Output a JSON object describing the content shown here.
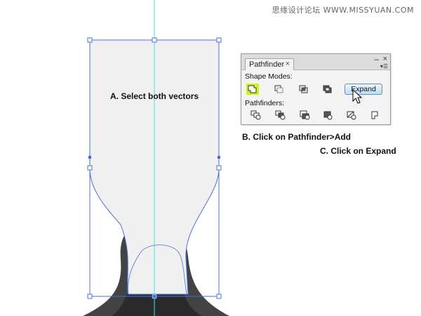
{
  "watermark": "思缘设计论坛 WWW.MISSYUAN.COM",
  "annotations": {
    "a": "A. Select both vectors",
    "b": "B. Click on Pathfinder>Add",
    "c": "C. Click on Expand"
  },
  "pathfinder_panel": {
    "tab_label": "Pathfinder",
    "tab_close": "×",
    "minimize": "–",
    "close": "×",
    "menu": "▾☰",
    "shape_modes_label": "Shape Modes:",
    "pathfinders_label": "Pathfinders:",
    "expand_label": "Expand",
    "shape_modes": [
      "unite-icon",
      "minus-front-icon",
      "intersect-icon",
      "exclude-icon"
    ],
    "pathfinders": [
      "divide-icon",
      "trim-icon",
      "merge-icon",
      "crop-icon",
      "outline-icon",
      "minus-back-icon"
    ]
  },
  "colors": {
    "guide": "#3fe4e4",
    "selection": "#4a6fd8",
    "fill_light": "#f0f0f0",
    "shape_dark": "#434343",
    "shape_darker": "#2b2b2b",
    "highlight": "#ccf510"
  }
}
